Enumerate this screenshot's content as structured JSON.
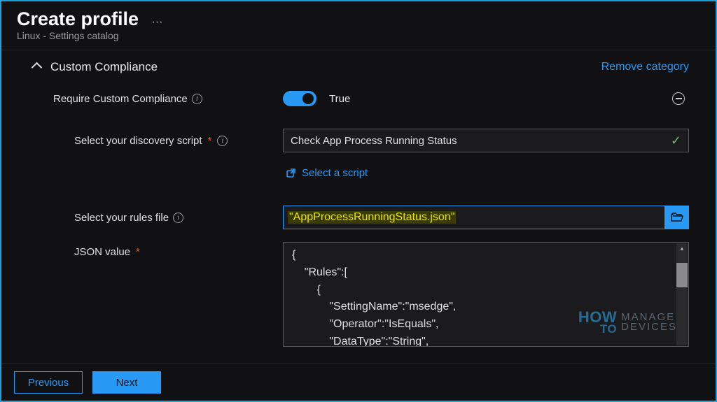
{
  "header": {
    "title": "Create profile",
    "subtitle": "Linux - Settings catalog",
    "menu_dots": "···"
  },
  "section": {
    "title": "Custom Compliance",
    "remove_label": "Remove category"
  },
  "fields": {
    "require_label": "Require Custom Compliance",
    "require_toggle_value": "True",
    "discovery_label": "Select your discovery script",
    "discovery_value": "Check App Process Running Status",
    "select_script_label": "Select a script",
    "rules_file_label": "Select your rules file",
    "rules_file_value": "\"AppProcessRunningStatus.json\"",
    "json_label": "JSON value",
    "json_value": "{\n    \"Rules\":[\n        {\n            \"SettingName\":\"msedge\",\n            \"Operator\":\"IsEquals\",\n            \"DataType\":\"String\",\n            \"Operand\":\"Running\""
  },
  "footer": {
    "previous": "Previous",
    "next": "Next"
  },
  "watermark": {
    "how": "HOW",
    "to": "TO",
    "line1": "MANAGE",
    "line2": "DEVICES"
  }
}
